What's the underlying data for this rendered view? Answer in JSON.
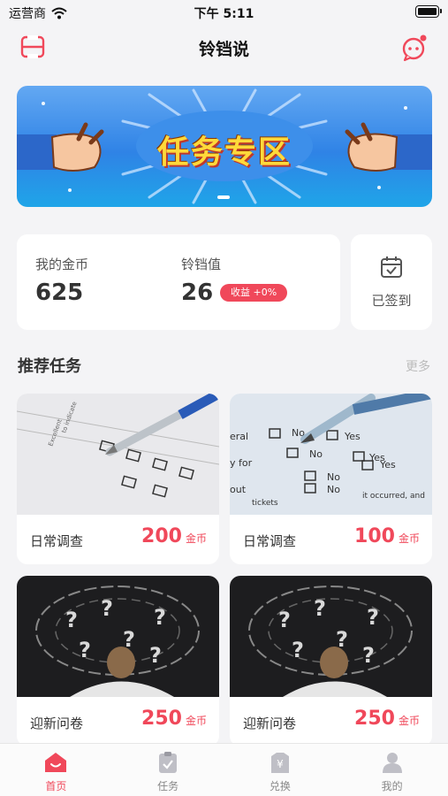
{
  "status_bar": {
    "carrier": "运营商",
    "time": "下午 5:11"
  },
  "nav": {
    "title": "铃铛说"
  },
  "banner": {
    "title": "任务专区"
  },
  "stats": {
    "coins_label": "我的金币",
    "coins_value": "625",
    "lingdang_label": "铃铛值",
    "lingdang_value": "26",
    "income_badge": "收益 +0%"
  },
  "checkin": {
    "label": "已签到"
  },
  "recommended": {
    "title": "推荐任务",
    "more": "更多",
    "tasks": [
      {
        "name": "日常调查",
        "reward": "200",
        "unit": "金币"
      },
      {
        "name": "日常调查",
        "reward": "100",
        "unit": "金币"
      },
      {
        "name": "迎新问卷",
        "reward": "250",
        "unit": "金币"
      },
      {
        "name": "迎新问卷",
        "reward": "250",
        "unit": "金币"
      }
    ]
  },
  "tabs": [
    {
      "label": "首页",
      "icon": "home-icon",
      "active": true
    },
    {
      "label": "任务",
      "icon": "task-icon",
      "active": false
    },
    {
      "label": "兑换",
      "icon": "exchange-icon",
      "active": false
    },
    {
      "label": "我的",
      "icon": "profile-icon",
      "active": false
    }
  ],
  "colors": {
    "accent": "#f0485a",
    "background": "#f4f4f6",
    "banner_blue": "#2f83e6",
    "banner_text": "#ffd93a"
  }
}
